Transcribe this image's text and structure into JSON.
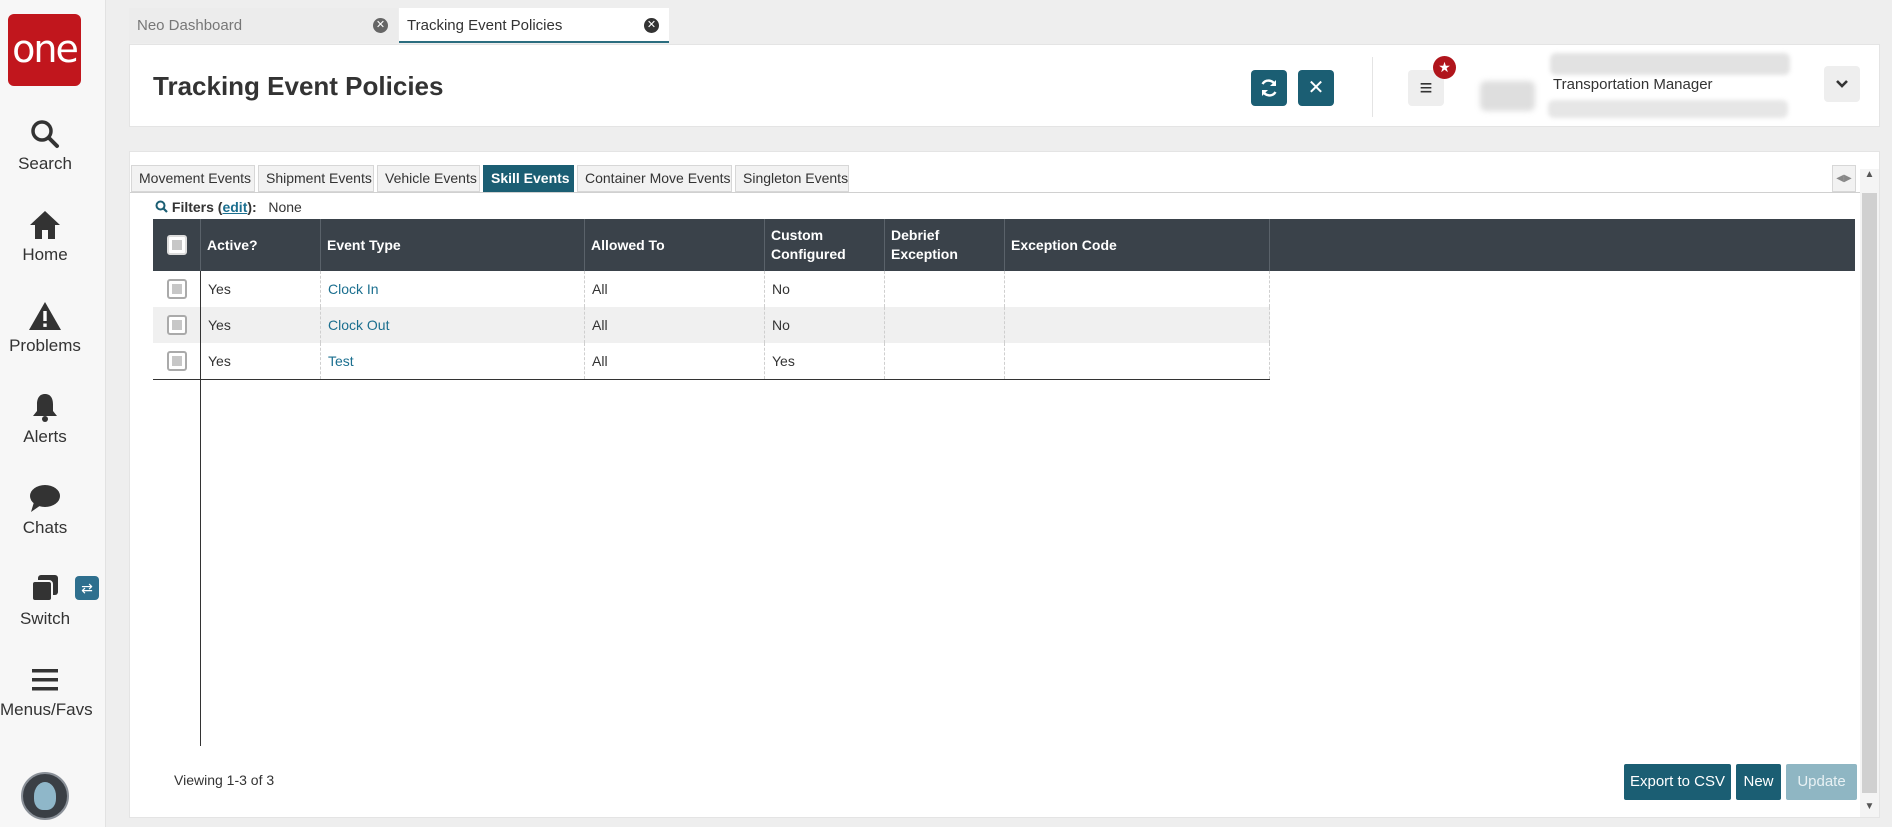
{
  "brand": {
    "logo_text": "one",
    "accent": "#c1161d",
    "primary": "#1b5e73"
  },
  "nav": {
    "items": [
      {
        "label": "Search",
        "icon": "search-icon"
      },
      {
        "label": "Home",
        "icon": "home-icon"
      },
      {
        "label": "Problems",
        "icon": "warning-icon"
      },
      {
        "label": "Alerts",
        "icon": "bell-icon"
      },
      {
        "label": "Chats",
        "icon": "chat-icon"
      },
      {
        "label": "Switch",
        "icon": "switch-icon"
      },
      {
        "label": "Menus/Favs",
        "icon": "hamburger-icon"
      }
    ]
  },
  "window_tabs": [
    {
      "label": "Neo Dashboard"
    },
    {
      "label": "Tracking Event Policies"
    }
  ],
  "header": {
    "title": "Tracking Event Policies",
    "role": "Transportation Manager"
  },
  "subtabs": [
    {
      "label": "Movement Events"
    },
    {
      "label": "Shipment Events"
    },
    {
      "label": "Vehicle Events"
    },
    {
      "label": "Skill Events"
    },
    {
      "label": "Container Move Events"
    },
    {
      "label": "Singleton Events"
    }
  ],
  "filters": {
    "label": "Filters",
    "edit": "edit",
    "value": "None"
  },
  "table": {
    "columns": [
      "Active?",
      "Event Type",
      "Allowed To",
      "Custom Configured",
      "Debrief Exception",
      "Exception Code"
    ],
    "rows": [
      {
        "active": "Yes",
        "event_type": "Clock In",
        "allowed_to": "All",
        "custom": "No",
        "debrief": "",
        "exception_code": ""
      },
      {
        "active": "Yes",
        "event_type": "Clock Out",
        "allowed_to": "All",
        "custom": "No",
        "debrief": "",
        "exception_code": ""
      },
      {
        "active": "Yes",
        "event_type": "Test",
        "allowed_to": "All",
        "custom": "Yes",
        "debrief": "",
        "exception_code": ""
      }
    ]
  },
  "footer": {
    "viewing": "Viewing 1-3 of 3",
    "export": "Export to CSV",
    "new": "New",
    "update": "Update"
  }
}
